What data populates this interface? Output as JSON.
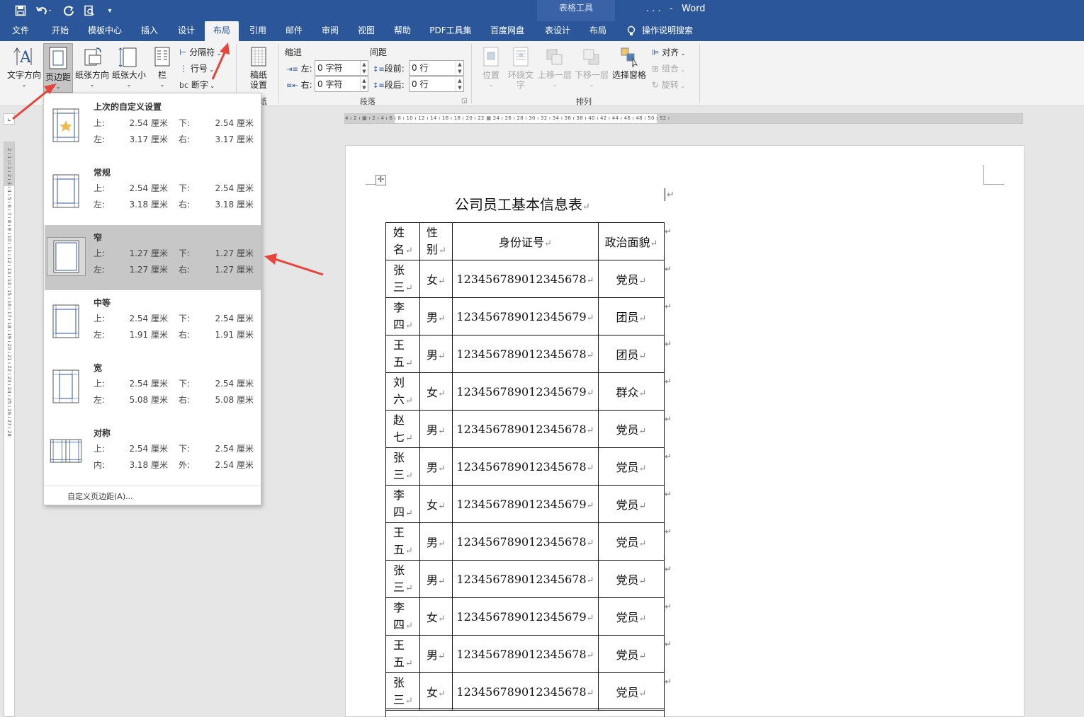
{
  "app": {
    "title": ". . .   -   Word",
    "context_tab_group": "表格工具"
  },
  "tabs": [
    {
      "label": "文件"
    },
    {
      "label": "开始"
    },
    {
      "label": "模板中心"
    },
    {
      "label": "插入"
    },
    {
      "label": "设计"
    },
    {
      "label": "布局"
    },
    {
      "label": "引用"
    },
    {
      "label": "邮件"
    },
    {
      "label": "审阅"
    },
    {
      "label": "视图"
    },
    {
      "label": "帮助"
    },
    {
      "label": "PDF工具集"
    },
    {
      "label": "百度网盘"
    },
    {
      "label": "表设计"
    },
    {
      "label": "布局"
    }
  ],
  "search": {
    "label": "操作说明搜索"
  },
  "ribbon": {
    "text_direction": "文字方向",
    "margins": "页边距",
    "orientation": "纸张方向",
    "size": "纸张大小",
    "columns": "栏",
    "breaks": "分隔符",
    "line_numbers": "行号",
    "hyphenation": "断字",
    "draft_paper": [
      "稿纸",
      "设置"
    ],
    "draft_group": "纸",
    "indent_title": "缩进",
    "spacing_title": "间距",
    "indent_left_label": "左:",
    "indent_left_value": "0 字符",
    "indent_right_label": "右:",
    "indent_right_value": "0 字符",
    "space_before_label": "段前:",
    "space_before_value": "0 行",
    "space_after_label": "段后:",
    "space_after_value": "0 行",
    "paragraph_group": "段落",
    "position": "位置",
    "wrap_text": [
      "环绕文",
      "字"
    ],
    "bring_forward": "上移一层",
    "send_backward": "下移一层",
    "selection_pane": "选择窗格",
    "align": "对齐",
    "group": "组合",
    "rotate": "旋转",
    "arrange_group": "排列"
  },
  "margins_menu": {
    "options": [
      {
        "name": "上次的自定义设置",
        "k1": "上:",
        "v1": "2.54 厘米",
        "k2": "下:",
        "v2": "2.54 厘米",
        "k3": "左:",
        "v3": "3.17 厘米",
        "k4": "右:",
        "v4": "3.17 厘米"
      },
      {
        "name": "常规",
        "k1": "上:",
        "v1": "2.54 厘米",
        "k2": "下:",
        "v2": "2.54 厘米",
        "k3": "左:",
        "v3": "3.18 厘米",
        "k4": "右:",
        "v4": "3.18 厘米"
      },
      {
        "name": "窄",
        "k1": "上:",
        "v1": "1.27 厘米",
        "k2": "下:",
        "v2": "1.27 厘米",
        "k3": "左:",
        "v3": "1.27 厘米",
        "k4": "右:",
        "v4": "1.27 厘米"
      },
      {
        "name": "中等",
        "k1": "上:",
        "v1": "2.54 厘米",
        "k2": "下:",
        "v2": "2.54 厘米",
        "k3": "左:",
        "v3": "1.91 厘米",
        "k4": "右:",
        "v4": "1.91 厘米"
      },
      {
        "name": "宽",
        "k1": "上:",
        "v1": "2.54 厘米",
        "k2": "下:",
        "v2": "2.54 厘米",
        "k3": "左:",
        "v3": "5.08 厘米",
        "k4": "右:",
        "v4": "5.08 厘米"
      },
      {
        "name": "对称",
        "k1": "上:",
        "v1": "2.54 厘米",
        "k2": "下:",
        "v2": "2.54 厘米",
        "k3": "内:",
        "v3": "3.18 厘米",
        "k4": "外:",
        "v4": "2.54 厘米"
      }
    ],
    "custom": "自定义页边距(A)..."
  },
  "document": {
    "title": "公司员工基本信息表",
    "headers": [
      "姓名",
      "性别",
      "身份证号",
      "政治面貌"
    ],
    "rows": [
      [
        "张三",
        "女",
        "123456789012345678",
        "党员"
      ],
      [
        "李四",
        "男",
        "123456789012345679",
        "团员"
      ],
      [
        "王五",
        "男",
        "123456789012345678",
        "团员"
      ],
      [
        "刘六",
        "女",
        "123456789012345679",
        "群众"
      ],
      [
        "赵七",
        "男",
        "123456789012345678",
        "党员"
      ],
      [
        "张三",
        "男",
        "123456789012345678",
        "党员"
      ],
      [
        "李四",
        "女",
        "123456789012345679",
        "党员"
      ],
      [
        "王五",
        "男",
        "123456789012345678",
        "党员"
      ],
      [
        "张三",
        "男",
        "123456789012345678",
        "党员"
      ],
      [
        "李四",
        "女",
        "123456789012345679",
        "党员"
      ],
      [
        "王五",
        "男",
        "123456789012345678",
        "党员"
      ],
      [
        "张三",
        "女",
        "123456789012345678",
        "党员"
      ]
    ]
  },
  "colors": {
    "accent": "#2b579a",
    "arrow": "#e8443a",
    "selected_option": "#c7c7c7"
  }
}
